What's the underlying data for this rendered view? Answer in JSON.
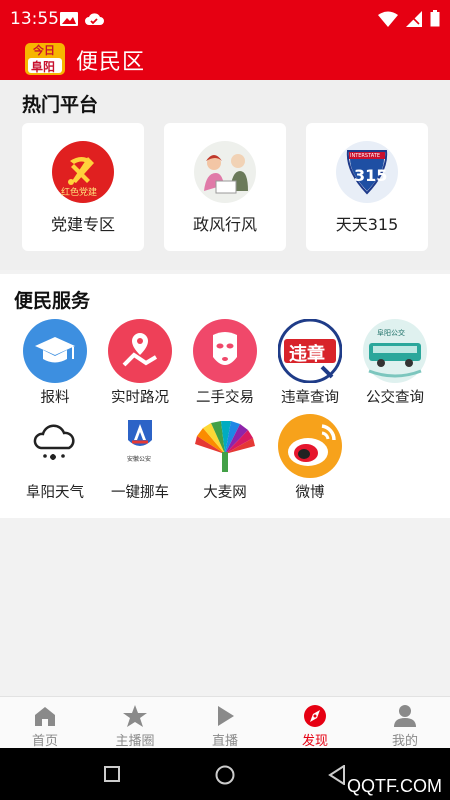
{
  "status_bar": {
    "time": "13:55"
  },
  "header": {
    "logo_text_top": "今日",
    "logo_text_bottom": "阜阳",
    "title": "便民区"
  },
  "hot": {
    "title": "热门平台",
    "cards": [
      {
        "label": "党建专区",
        "icon": "party-emblem-icon",
        "icon_text": "红色党建"
      },
      {
        "label": "政风行风",
        "icon": "people-meeting-icon"
      },
      {
        "label": "天天315",
        "icon": "interstate-315-icon",
        "icon_text": "315",
        "icon_subtext": "INTERSTATE"
      }
    ]
  },
  "services": {
    "title": "便民服务",
    "items": [
      {
        "label": "报料",
        "icon": "graduation-cap-icon"
      },
      {
        "label": "实时路况",
        "icon": "map-pin-icon"
      },
      {
        "label": "二手交易",
        "icon": "mask-icon"
      },
      {
        "label": "违章查询",
        "icon": "violation-badge-icon",
        "icon_text": "违章"
      },
      {
        "label": "公交查询",
        "icon": "bus-icon",
        "icon_text": "阜阳公交"
      },
      {
        "label": "阜阳天气",
        "icon": "cloud-snow-icon"
      },
      {
        "label": "一键挪车",
        "icon": "police-shield-icon",
        "icon_text": "安徽公安"
      },
      {
        "label": "大麦网",
        "icon": "peacock-icon"
      },
      {
        "label": "微博",
        "icon": "weibo-icon"
      }
    ]
  },
  "tabs": [
    {
      "label": "首页",
      "icon": "home-icon"
    },
    {
      "label": "主播圈",
      "icon": "star-icon"
    },
    {
      "label": "直播",
      "icon": "play-icon"
    },
    {
      "label": "发现",
      "icon": "compass-icon",
      "active": true
    },
    {
      "label": "我的",
      "icon": "person-icon"
    }
  ],
  "watermark": "QQTF.COM",
  "colors": {
    "brand_red": "#e60012",
    "tab_inactive": "#8a8a8a"
  }
}
